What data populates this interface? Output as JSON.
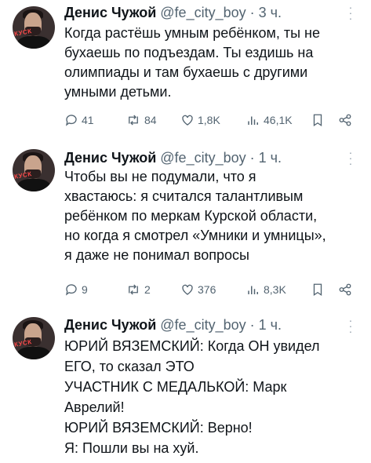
{
  "tweets": [
    {
      "author_name": "Денис Чужой",
      "handle": "@fe_city_boy",
      "dot": "·",
      "time": "3 ч.",
      "avatar_tag": "КУСК",
      "lines": [
        "Когда растёшь умным ребёнком, ты не",
        "бухаешь по подъездам. Ты ездишь на",
        "олимпиады и там бухаешь с другими",
        "умными детьми."
      ],
      "replies": "41",
      "retweets": "84",
      "likes": "1,8K",
      "views": "46,1K"
    },
    {
      "author_name": "Денис Чужой",
      "handle": "@fe_city_boy",
      "dot": "·",
      "time": "1 ч.",
      "avatar_tag": "КУСК",
      "lines": [
        "Чтобы вы не подумали, что я",
        "хвастаюсь: я считался талантливым",
        "ребёнком по меркам Курской области,",
        "но когда я смотрел «Умники и умницы»,",
        "я даже не понимал вопросы"
      ],
      "replies": "9",
      "retweets": "2",
      "likes": "376",
      "views": "8,3K"
    },
    {
      "author_name": "Денис Чужой",
      "handle": "@fe_city_boy",
      "dot": "·",
      "time": "1 ч.",
      "avatar_tag": "КУСК",
      "lines": [
        "ЮРИЙ ВЯЗЕМСКИЙ: Когда ОН увидел",
        "ЕГО, то сказал ЭТО",
        "УЧАСТНИК С МЕДАЛЬКОЙ: Марк",
        "Аврелий!",
        "ЮРИЙ ВЯЗЕМСКИЙ: Верно!",
        "Я: Пошли вы на хуй."
      ]
    }
  ],
  "icons": {
    "reply": "reply-icon",
    "retweet": "retweet-icon",
    "like": "heart-icon",
    "views": "views-icon",
    "bookmark": "bookmark-icon",
    "share": "share-icon",
    "more": "more-icon"
  },
  "colors": {
    "text": "#0f1419",
    "secondary": "#536471",
    "background": "#ffffff"
  }
}
